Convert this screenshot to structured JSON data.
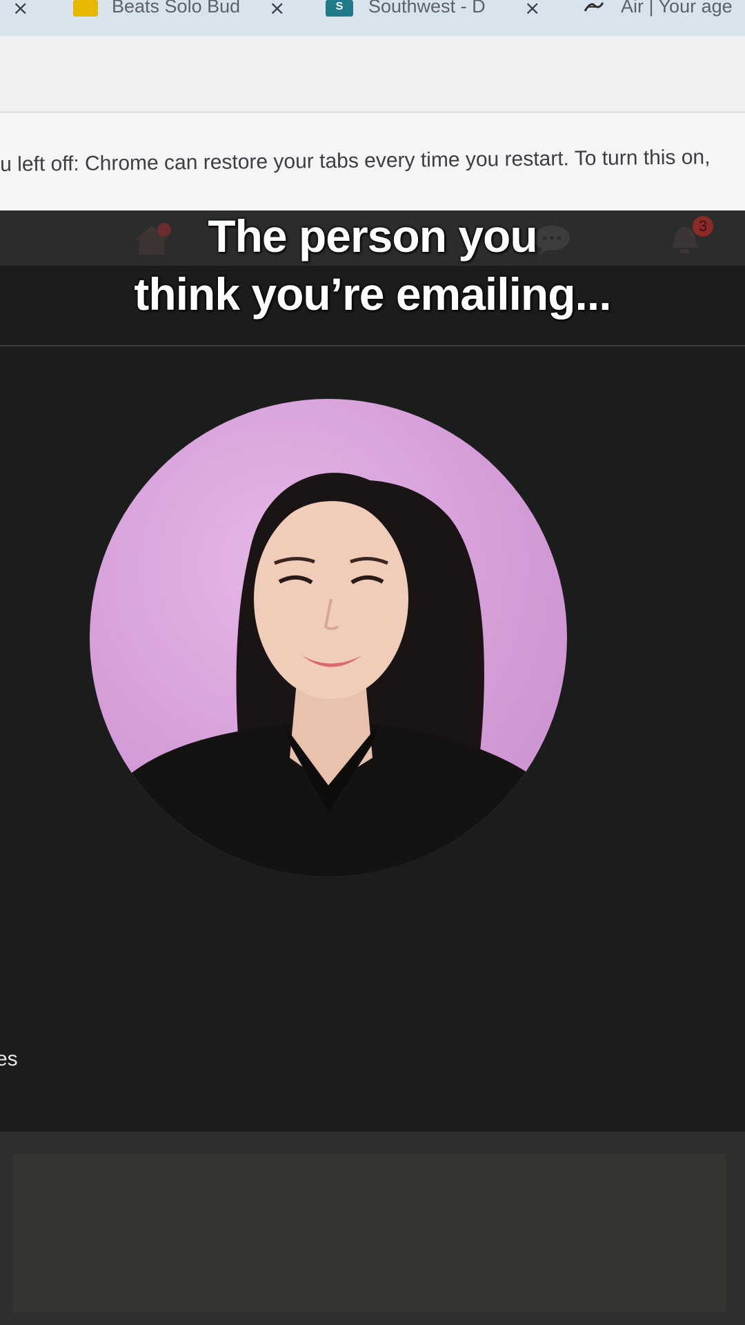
{
  "browser": {
    "tabs": [
      {
        "title": "Beats Solo Bud",
        "favicon": "yellow-square-icon",
        "favicon_color": "#e6b800"
      },
      {
        "title": "Southwest - D",
        "favicon": "sharepoint-icon",
        "favicon_color": "#1f7a8c"
      },
      {
        "title": "Air | Your age",
        "favicon": "air-script-icon"
      }
    ],
    "tab_close_glyph": "×",
    "restore_bar_text": "u left off: Chrome can restore your tabs every time you restart. To turn this on, "
  },
  "app": {
    "nav_icons": [
      "home-icon",
      "chat-icon",
      "bell-icon"
    ],
    "notification_count": "3",
    "side_text": "es"
  },
  "caption": {
    "line1": "The person you",
    "line2": "think you’re emailing..."
  },
  "colors": {
    "photo_background": "#d59cd8",
    "app_background": "#1b1d1c"
  }
}
